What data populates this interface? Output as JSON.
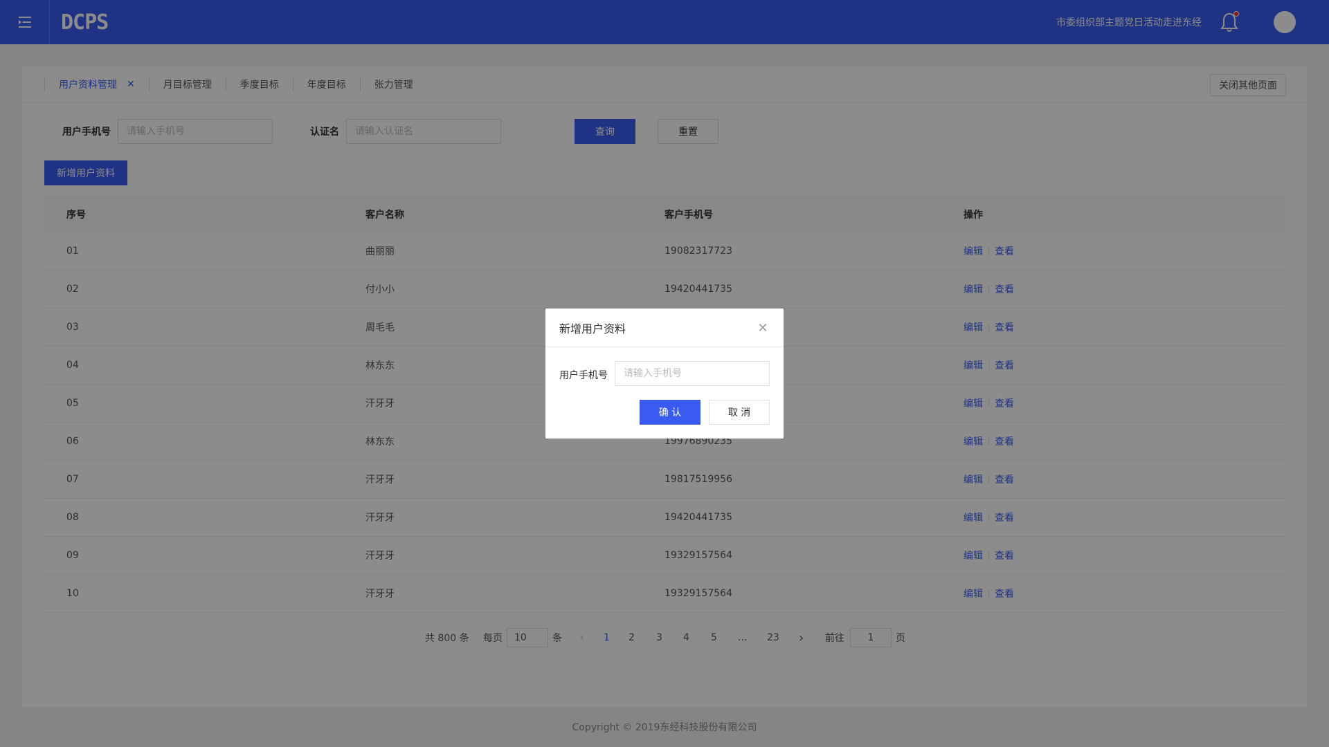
{
  "header": {
    "logo_text": "DCPS",
    "org_name": "市委组织部主题党日活动走进东经",
    "colors": {
      "primary": "#3a5bef",
      "notification_dot": "#ff2b2b"
    }
  },
  "tabs": [
    {
      "label": "用户资料管理",
      "active": true,
      "closable": true
    },
    {
      "label": "月目标管理"
    },
    {
      "label": "季度目标"
    },
    {
      "label": "年度目标"
    },
    {
      "label": "张力管理"
    }
  ],
  "close_others_label": "关闭其他页面",
  "search": {
    "phone_label": "用户手机号",
    "phone_placeholder": "请输入手机号",
    "cert_label": "认证名",
    "cert_placeholder": "请输入认证名",
    "query_label": "查询",
    "reset_label": "重置"
  },
  "add_button_label": "新增用户资料",
  "table": {
    "columns": [
      "序号",
      "客户名称",
      "客户手机号",
      "操作"
    ],
    "edit_label": "编辑",
    "view_label": "查看",
    "rows": [
      {
        "no": "01",
        "name": "曲丽丽",
        "phone": "19082317723"
      },
      {
        "no": "02",
        "name": "付小小",
        "phone": "19420441735"
      },
      {
        "no": "03",
        "name": "周毛毛",
        "phone": ""
      },
      {
        "no": "04",
        "name": "林东东",
        "phone": ""
      },
      {
        "no": "05",
        "name": "汗牙牙",
        "phone": ""
      },
      {
        "no": "06",
        "name": "林东东",
        "phone": "19976890235"
      },
      {
        "no": "07",
        "name": "汗牙牙",
        "phone": "19817519956"
      },
      {
        "no": "08",
        "name": "汗牙牙",
        "phone": "19420441735"
      },
      {
        "no": "09",
        "name": "汗牙牙",
        "phone": "19329157564"
      },
      {
        "no": "10",
        "name": "汗牙牙",
        "phone": "19329157564"
      }
    ]
  },
  "pagination": {
    "total_text": "共 800 条",
    "per_page_label": "每页",
    "per_page_value": "10",
    "per_page_unit": "条",
    "pages": [
      "1",
      "2",
      "3",
      "4",
      "5",
      "...",
      "23"
    ],
    "current_page": "1",
    "goto_label": "前往",
    "goto_value": "1",
    "goto_unit": "页"
  },
  "footer": {
    "copyright": "Copyright © 2019东经科技股份有限公司"
  },
  "modal": {
    "title": "新增用户资料",
    "phone_label": "用户手机号",
    "phone_placeholder": "请输入手机号",
    "confirm_label": "确 认",
    "cancel_label": "取 消"
  }
}
